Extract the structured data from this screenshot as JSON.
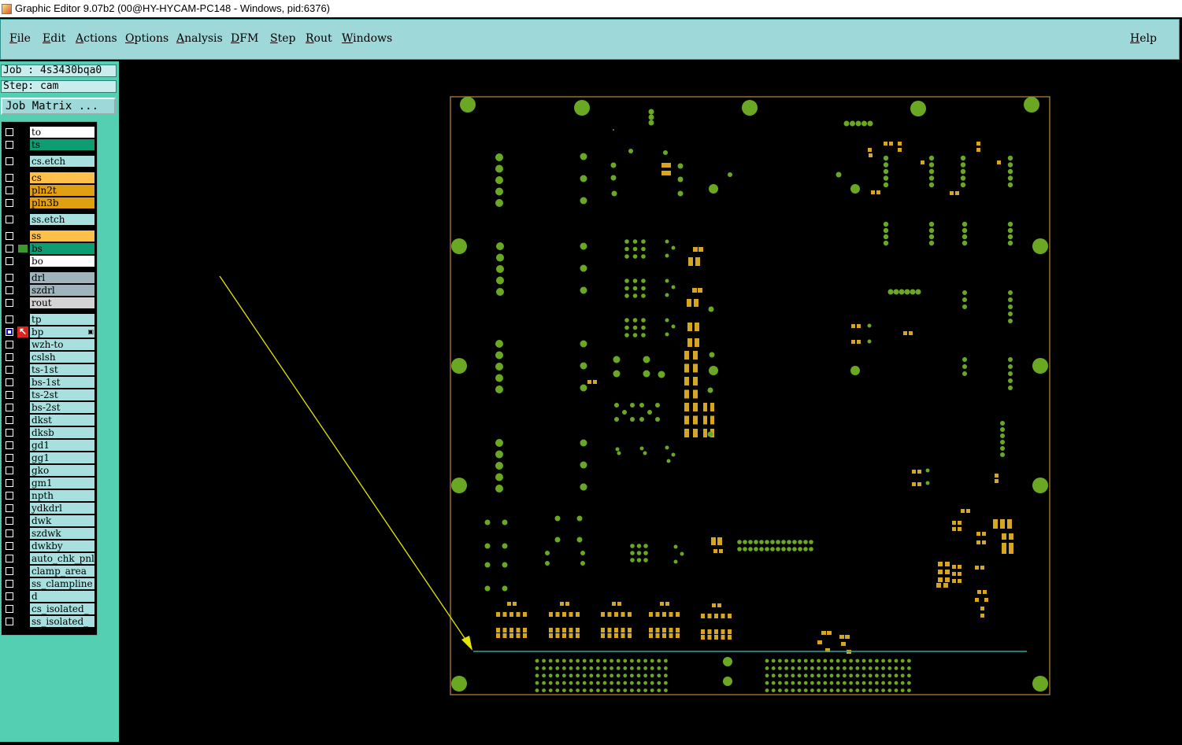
{
  "window": {
    "title": "Graphic Editor 9.07b2 (00@HY-HYCAM-PC148 - Windows, pid:6376)"
  },
  "menu": {
    "items": [
      {
        "label": "File"
      },
      {
        "label": "Edit"
      },
      {
        "label": "Actions"
      },
      {
        "label": "Options"
      },
      {
        "label": "Analysis"
      },
      {
        "label": "DFM"
      },
      {
        "label": "Step"
      },
      {
        "label": "Rout"
      },
      {
        "label": "Windows"
      }
    ],
    "help": "Help"
  },
  "job_info": {
    "job": "Job : 4s3430bqa0",
    "step": "Step: cam",
    "job_matrix_button": "Job Matrix ..."
  },
  "layers": [
    {
      "name": "to",
      "color": "#ffffff"
    },
    {
      "name": "ts",
      "color": "#0e9c72"
    },
    {
      "name": "cs.etch",
      "color": "#a8e0e0"
    },
    {
      "name": "cs",
      "color": "#ffc04a"
    },
    {
      "name": "pln2t",
      "color": "#e0a012"
    },
    {
      "name": "pln3b",
      "color": "#e0a012"
    },
    {
      "name": "ss.etch",
      "color": "#a8e0e0"
    },
    {
      "name": "ss",
      "color": "#ffc04a"
    },
    {
      "name": "bs",
      "color": "#0e9c72",
      "indicator": "green"
    },
    {
      "name": "bo",
      "color": "#ffffff"
    },
    {
      "name": "drl",
      "color": "#9fb4bc"
    },
    {
      "name": "szdrl",
      "color": "#9fb4bc"
    },
    {
      "name": "rout",
      "color": "#d4d4d4"
    },
    {
      "name": "tp",
      "color": "#a8e0e0"
    },
    {
      "name": "bp",
      "color": "#a8e0e0",
      "indicator": "red",
      "checked": true
    },
    {
      "name": "wzh-to",
      "color": "#a8e0e0"
    },
    {
      "name": "cslsh",
      "color": "#a8e0e0"
    },
    {
      "name": "ts-1st",
      "color": "#a8e0e0"
    },
    {
      "name": "bs-1st",
      "color": "#a8e0e0"
    },
    {
      "name": "ts-2st",
      "color": "#a8e0e0"
    },
    {
      "name": "bs-2st",
      "color": "#a8e0e0"
    },
    {
      "name": "dkst",
      "color": "#a8e0e0"
    },
    {
      "name": "dksb",
      "color": "#a8e0e0"
    },
    {
      "name": "gd1",
      "color": "#a8e0e0"
    },
    {
      "name": "gg1",
      "color": "#a8e0e0"
    },
    {
      "name": "gko",
      "color": "#a8e0e0"
    },
    {
      "name": "gm1",
      "color": "#a8e0e0"
    },
    {
      "name": "npth",
      "color": "#a8e0e0"
    },
    {
      "name": "ydkdrl",
      "color": "#a8e0e0"
    },
    {
      "name": "dwk",
      "color": "#a8e0e0"
    },
    {
      "name": "szdwk",
      "color": "#a8e0e0"
    },
    {
      "name": "dwkby",
      "color": "#a8e0e0"
    },
    {
      "name": "auto_chk_pnl",
      "color": "#a8e0e0"
    },
    {
      "name": "clamp_area",
      "color": "#a8e0e0"
    },
    {
      "name": "ss_clampline",
      "color": "#a8e0e0"
    },
    {
      "name": "d",
      "color": "#a8e0e0"
    },
    {
      "name": "cs_isolated_",
      "color": "#a8e0e0"
    },
    {
      "name": "ss_isolated_",
      "color": "#a8e0e0"
    }
  ],
  "colors": {
    "pad_green": "#6aa823",
    "pad_yellow": "#d6a521",
    "outline": "#b98a3a",
    "annotation": "#e6e600",
    "trace": "#2aa3a3"
  }
}
